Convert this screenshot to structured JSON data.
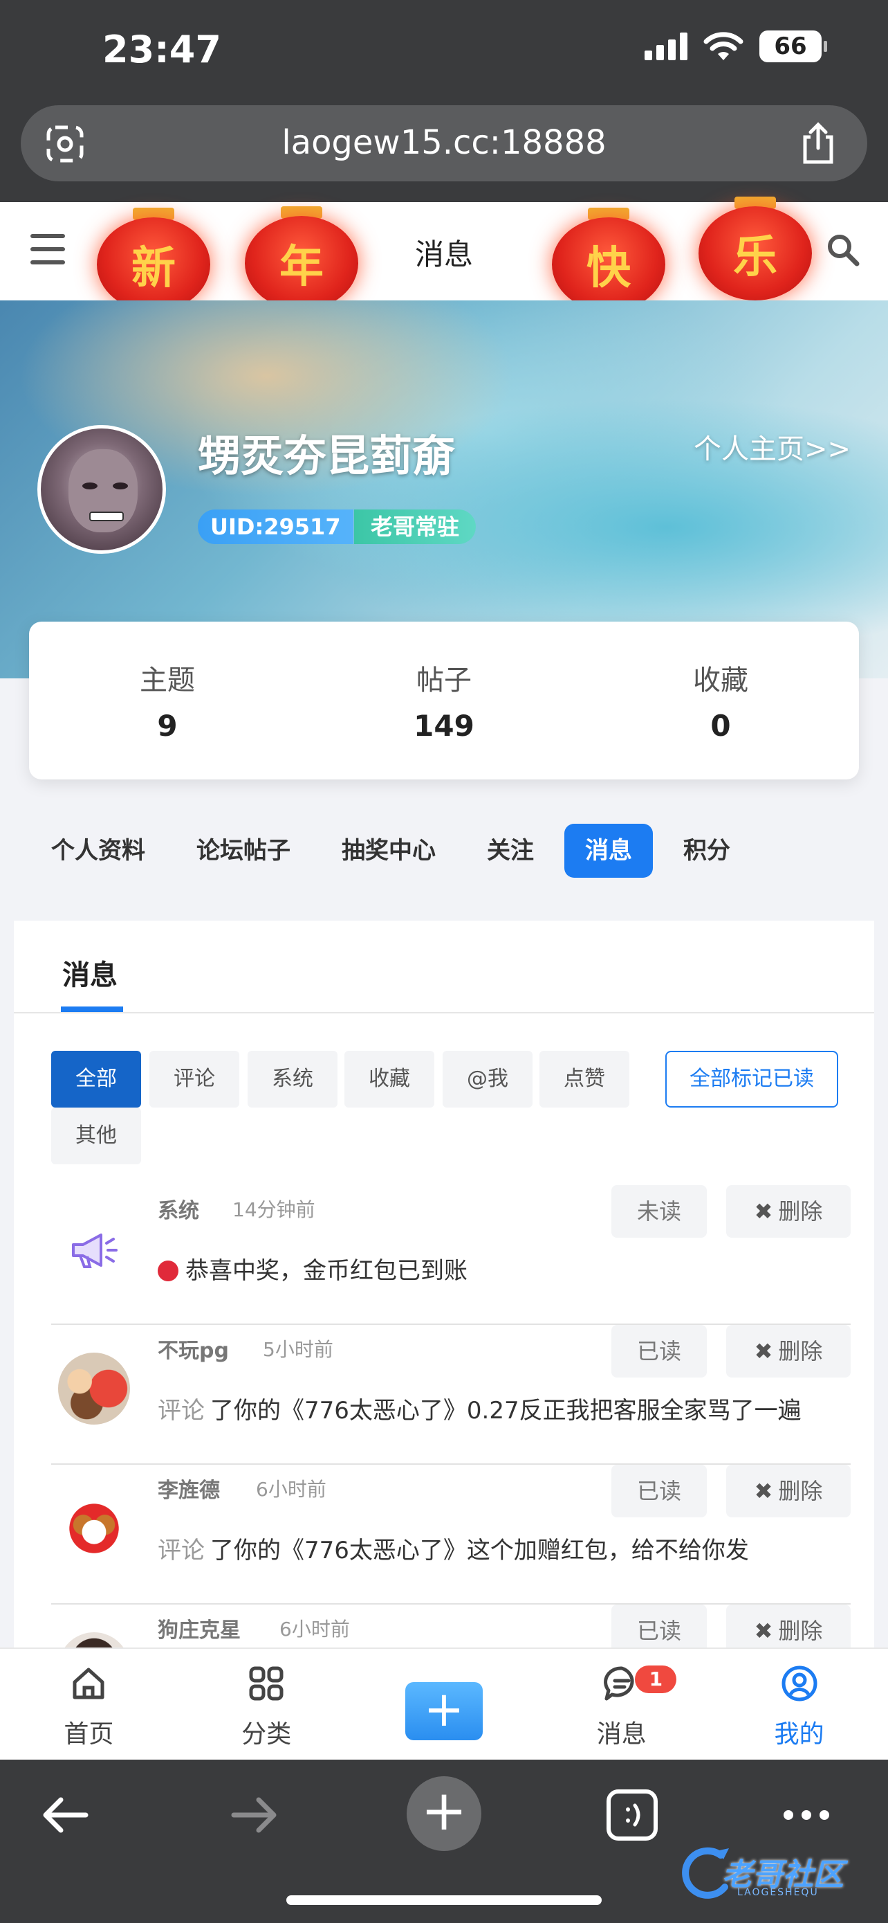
{
  "status_bar": {
    "time": "23:47",
    "battery": "66"
  },
  "browser": {
    "url": "laogew15.cc:18888"
  },
  "header": {
    "title": "消息",
    "lanterns": [
      "新",
      "年",
      "快",
      "乐"
    ]
  },
  "profile": {
    "username": "甥烎夯昆菿奟",
    "homepage_link": "个人主页>>",
    "uid": "UID:29517",
    "role": "老哥常驻"
  },
  "stats": [
    {
      "label": "主题",
      "value": "9"
    },
    {
      "label": "帖子",
      "value": "149"
    },
    {
      "label": "收藏",
      "value": "0"
    }
  ],
  "profile_tabs": [
    "个人资料",
    "论坛帖子",
    "抽奖中心",
    "关注",
    "消息",
    "积分"
  ],
  "profile_tabs_active": "消息",
  "panel": {
    "title": "消息",
    "filters": [
      "全部",
      "评论",
      "系统",
      "收藏",
      "@我",
      "点赞",
      "其他"
    ],
    "active_filter": "全部",
    "mark_all_read": "全部标记已读"
  },
  "messages": [
    {
      "name": "系统",
      "time": "14分钟前",
      "status": "未读",
      "delete": "删除",
      "prefix": "",
      "body": "恭喜中奖，金币红包已到账"
    },
    {
      "name": "不玩pg",
      "time": "5小时前",
      "status": "已读",
      "delete": "删除",
      "prefix": "评论",
      "body": "了你的《776太恶心了》0.27反正我把客服全家骂了一遍"
    },
    {
      "name": "李旌德",
      "time": "6小时前",
      "status": "已读",
      "delete": "删除",
      "prefix": "评论",
      "body": "了你的《776太恶心了》这个加赠红包，给不给你发"
    },
    {
      "name": "狗庄克星",
      "time": "6小时前",
      "status": "已读",
      "delete": "删除",
      "prefix": "",
      "body": ""
    }
  ],
  "bottom_nav": {
    "items": [
      {
        "label": "首页",
        "icon": "home-icon"
      },
      {
        "label": "分类",
        "icon": "grid-icon"
      },
      {
        "label": "",
        "icon": "plus-icon"
      },
      {
        "label": "消息",
        "icon": "chat-icon",
        "badge": "1"
      },
      {
        "label": "我的",
        "icon": "user-icon"
      }
    ],
    "active": "我的"
  },
  "watermark": {
    "text": "老哥社区",
    "sub": "LAOGESHEQU"
  },
  "colors": {
    "accent": "#1c7cf2",
    "unread_dot": "#e02a3a",
    "badge": "#f0493f"
  }
}
